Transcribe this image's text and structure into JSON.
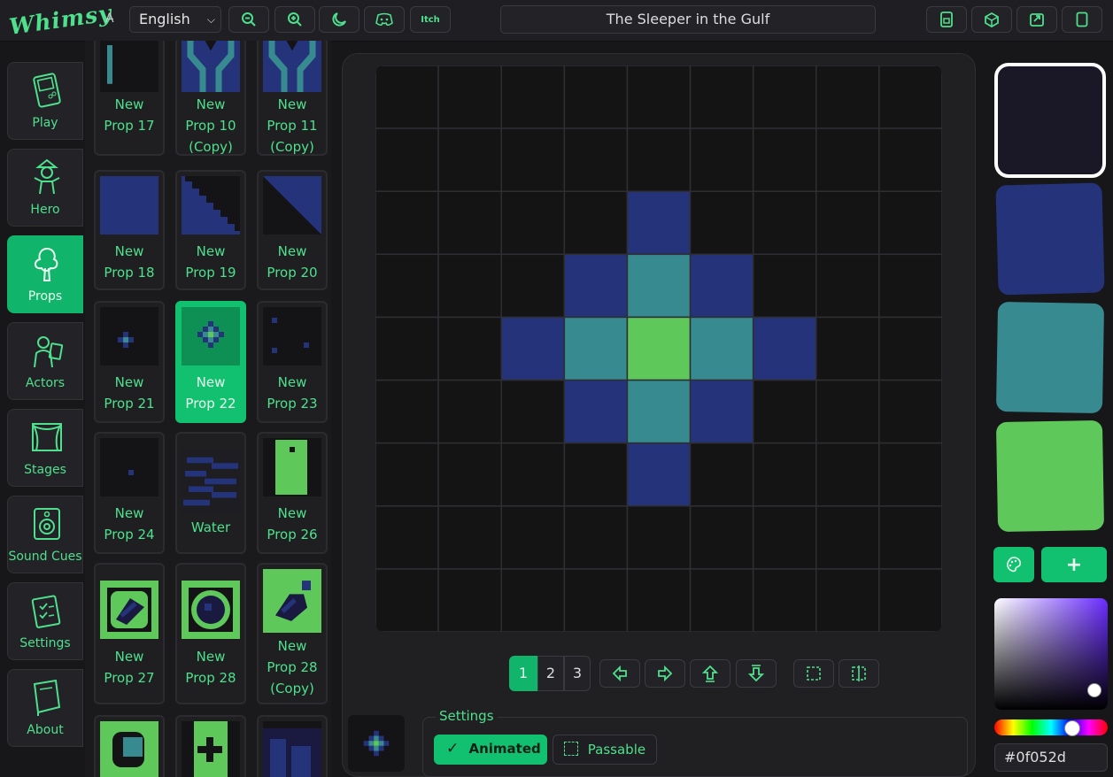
{
  "app": {
    "logo": "Whimsy",
    "language": "English",
    "project_title": "The Sleeper in the Gulf",
    "itch_label": "Itch"
  },
  "sidebar": {
    "items": [
      {
        "label": "Play",
        "icon": "gameboy-icon"
      },
      {
        "label": "Hero",
        "icon": "hero-icon"
      },
      {
        "label": "Props",
        "icon": "tree-icon",
        "active": true
      },
      {
        "label": "Actors",
        "icon": "actor-icon"
      },
      {
        "label": "Stages",
        "icon": "stage-curtain-icon"
      },
      {
        "label": "Sound Cues",
        "icon": "speaker-icon"
      },
      {
        "label": "Settings",
        "icon": "clipboard-icon"
      },
      {
        "label": "About",
        "icon": "book-icon"
      }
    ]
  },
  "props": {
    "cards": [
      {
        "line1": "New",
        "line2": "Prop 17",
        "line3": ""
      },
      {
        "line1": "New",
        "line2": "Prop 10",
        "line3": "(Copy)"
      },
      {
        "line1": "New",
        "line2": "Prop 11",
        "line3": "(Copy)"
      },
      {
        "line1": "New",
        "line2": "Prop 18",
        "line3": ""
      },
      {
        "line1": "New",
        "line2": "Prop 19",
        "line3": ""
      },
      {
        "line1": "New",
        "line2": "Prop 20",
        "line3": ""
      },
      {
        "line1": "New",
        "line2": "Prop 21",
        "line3": ""
      },
      {
        "line1": "New",
        "line2": "Prop 22",
        "line3": "",
        "active": true
      },
      {
        "line1": "New",
        "line2": "Prop 23",
        "line3": ""
      },
      {
        "line1": "New",
        "line2": "Prop 24",
        "line3": ""
      },
      {
        "line1": "Water",
        "line2": "",
        "line3": ""
      },
      {
        "line1": "New",
        "line2": "Prop 26",
        "line3": ""
      },
      {
        "line1": "New",
        "line2": "Prop 27",
        "line3": ""
      },
      {
        "line1": "New",
        "line2": "Prop 28",
        "line3": ""
      },
      {
        "line1": "New",
        "line2": "Prop 28",
        "line3": "(Copy)"
      }
    ]
  },
  "editor": {
    "frames": [
      "1",
      "2",
      "3"
    ],
    "active_frame": "1",
    "pixels": [
      "000000000",
      "000000000",
      "000010000",
      "000121000",
      "001232100",
      "000121000",
      "000010000",
      "000000000",
      "000000000"
    ],
    "settings_title": "Settings",
    "animated_label": "Animated",
    "passable_label": "Passable"
  },
  "palette": {
    "colors": [
      "#1a1726",
      "#24337a",
      "#378a8f",
      "#5ec85b"
    ],
    "selected_index": 0,
    "hex_value": "#0f052d",
    "grid_bg": "#141414"
  },
  "colors": {
    "accent": "#11c170",
    "accent_text": "#4ee08c"
  }
}
